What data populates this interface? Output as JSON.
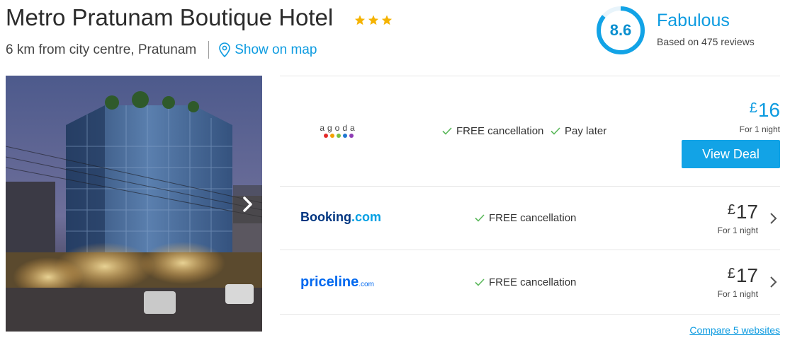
{
  "hotel": {
    "name": "Metro Pratunam Boutique Hotel",
    "star_count": 3,
    "distance": "6 km from city centre, Pratunam",
    "map_link": "Show on map"
  },
  "rating": {
    "score": "8.6",
    "score_fraction": 0.86,
    "label": "Fabulous",
    "reviews": "Based on 475 reviews"
  },
  "photo": {
    "icon": "chevron-right-icon"
  },
  "deals": [
    {
      "provider": "agoda",
      "features": [
        "FREE cancellation",
        "Pay later"
      ],
      "currency": "£",
      "price": "16",
      "per_night": "For 1 night",
      "cta": "View Deal"
    },
    {
      "provider": "Booking.com",
      "provider_parts": [
        "Booking",
        ".com"
      ],
      "features": [
        "FREE cancellation"
      ],
      "currency": "£",
      "price": "17",
      "per_night": "For 1 night"
    },
    {
      "provider": "priceline.com",
      "provider_parts": [
        "priceline",
        ".com"
      ],
      "features": [
        "FREE cancellation"
      ],
      "currency": "£",
      "price": "17",
      "per_night": "For 1 night"
    }
  ],
  "compare_link": "Compare 5 websites",
  "colors": {
    "accent": "#0d9be0",
    "button": "#12a3e6",
    "star": "#f5b301",
    "check": "#5bb85b",
    "booking_dark": "#003580",
    "booking_light": "#009fe3",
    "priceline": "#0068ef"
  }
}
